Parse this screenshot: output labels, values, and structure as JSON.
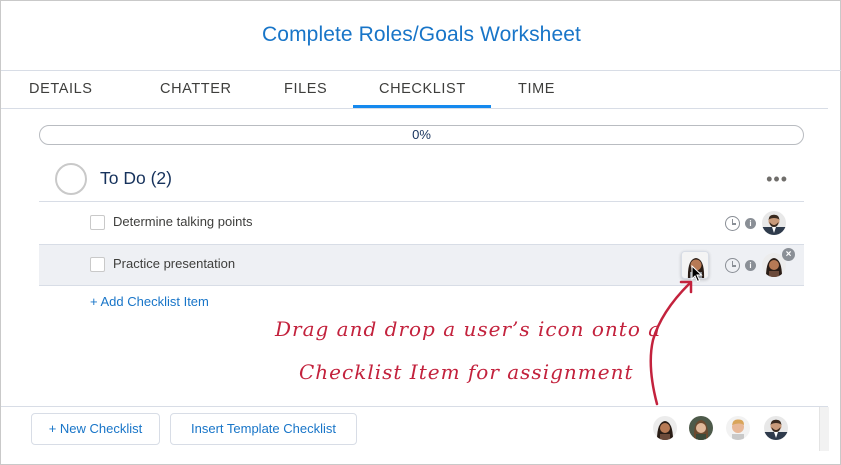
{
  "header": {
    "title": "Complete Roles/Goals Worksheet"
  },
  "tabs": [
    {
      "label": "DETAILS"
    },
    {
      "label": "CHATTER"
    },
    {
      "label": "FILES"
    },
    {
      "label": "CHECKLIST",
      "active": true
    },
    {
      "label": "TIME"
    }
  ],
  "progress": {
    "label": "0%",
    "value": 0
  },
  "checklist": {
    "group_label": "To Do (2)",
    "more_label": "•••",
    "items": [
      {
        "label": "Determine talking points",
        "checked": false
      },
      {
        "label": "Practice presentation",
        "checked": false
      }
    ],
    "add_item_label": "+ Add Checklist Item"
  },
  "annotation": {
    "line1": "Drag and drop a user’s icon onto a",
    "line2": "Checklist Item for assignment"
  },
  "footer": {
    "new_checklist_label": "+ New Checklist",
    "insert_template_label": "Insert Template Checklist"
  },
  "icons": {
    "clock": "clock-icon",
    "info": "info-icon",
    "close": "close-icon",
    "more": "more-icon"
  },
  "colors": {
    "accent": "#1589ee",
    "link": "#1875c8",
    "annotation": "#c3223d"
  }
}
